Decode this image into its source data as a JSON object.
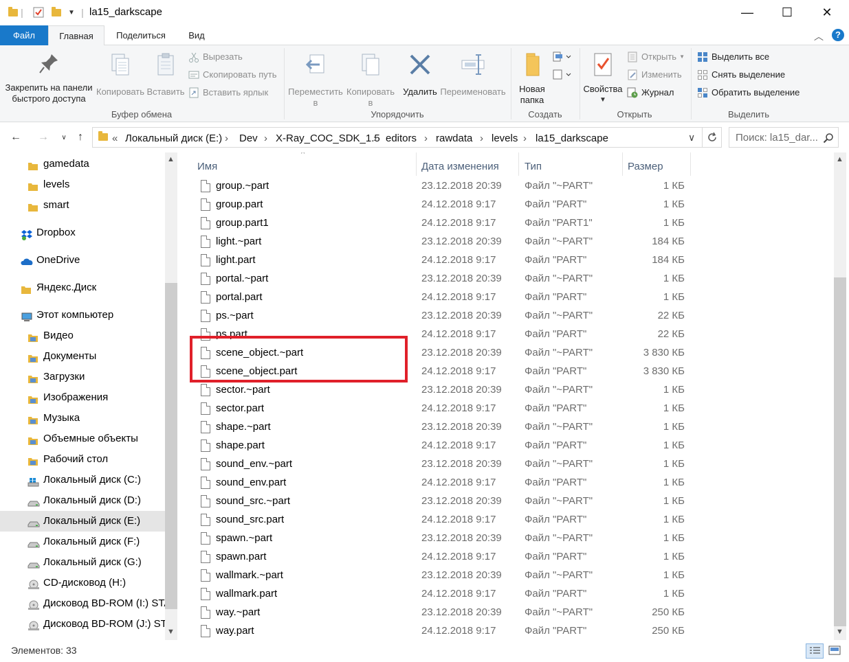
{
  "window": {
    "title": "la15_darkscape",
    "controls": {
      "minimize": "—",
      "maximize": "☐",
      "close": "✕"
    }
  },
  "ribbon_tabs": [
    {
      "label": "Файл"
    },
    {
      "label": "Главная"
    },
    {
      "label": "Поделиться"
    },
    {
      "label": "Вид"
    }
  ],
  "ribbon": {
    "clipboard": {
      "pin_line1": "Закрепить на панели",
      "pin_line2": "быстрого доступа",
      "copy": "Копировать",
      "paste": "Вставить",
      "cut": "Вырезать",
      "copy_path": "Скопировать путь",
      "paste_shortcut": "Вставить ярлык",
      "group": "Буфер обмена"
    },
    "organize": {
      "move_line1": "Переместить",
      "move_line2": "в",
      "copyto_line1": "Копировать",
      "copyto_line2": "в",
      "delete": "Удалить",
      "rename": "Переименовать",
      "group": "Упорядочить"
    },
    "create": {
      "new_folder_line1": "Новая",
      "new_folder_line2": "папка",
      "group": "Создать"
    },
    "open": {
      "properties": "Свойства",
      "open": "Открыть",
      "edit": "Изменить",
      "history": "Журнал",
      "group": "Открыть"
    },
    "select": {
      "select_all": "Выделить все",
      "select_none": "Снять выделение",
      "invert": "Обратить выделение",
      "group": "Выделить"
    }
  },
  "address": {
    "overflow": "«",
    "crumbs": [
      "Локальный диск (E:)",
      "Dev",
      "X-Ray_COC_SDK_1.5",
      "editors",
      "rawdata",
      "levels",
      "la15_darkscape"
    ],
    "search_placeholder": "Поиск: la15_dar..."
  },
  "nav": {
    "items": [
      {
        "label": "gamedata",
        "icon": "folder-icon"
      },
      {
        "label": "levels",
        "icon": "folder-icon"
      },
      {
        "label": "smart",
        "icon": "folder-icon"
      },
      {
        "label": "Dropbox",
        "icon": "dropbox-icon"
      },
      {
        "label": "OneDrive",
        "icon": "onedrive-icon"
      },
      {
        "label": "Яндекс.Диск",
        "icon": "folder-icon"
      },
      {
        "label": "Этот компьютер",
        "icon": "computer-icon"
      },
      {
        "label": "Видео",
        "icon": "video-folder-icon"
      },
      {
        "label": "Документы",
        "icon": "documents-folder-icon"
      },
      {
        "label": "Загрузки",
        "icon": "downloads-folder-icon"
      },
      {
        "label": "Изображения",
        "icon": "pictures-folder-icon"
      },
      {
        "label": "Музыка",
        "icon": "music-folder-icon"
      },
      {
        "label": "Объемные объекты",
        "icon": "3d-objects-folder-icon"
      },
      {
        "label": "Рабочий стол",
        "icon": "desktop-folder-icon"
      },
      {
        "label": "Локальный диск (C:)",
        "icon": "windows-drive-icon"
      },
      {
        "label": "Локальный диск (D:)",
        "icon": "drive-icon"
      },
      {
        "label": "Локальный диск (E:)",
        "icon": "drive-icon"
      },
      {
        "label": "Локальный диск (F:)",
        "icon": "drive-icon"
      },
      {
        "label": "Локальный диск (G:)",
        "icon": "drive-icon"
      },
      {
        "label": "CD-дисковод (H:)",
        "icon": "cd-drive-icon"
      },
      {
        "label": "Дисковод BD-ROM (I:) STA",
        "icon": "cd-drive-icon"
      },
      {
        "label": "Дисковод BD-ROM (J:) STA",
        "icon": "cd-drive-icon"
      }
    ]
  },
  "columns": {
    "name": "Имя",
    "date": "Дата изменения",
    "type": "Тип",
    "size": "Размер"
  },
  "files": [
    {
      "name": "group.~part",
      "date": "23.12.2018 20:39",
      "type": "Файл \"~PART\"",
      "size": "1 КБ"
    },
    {
      "name": "group.part",
      "date": "24.12.2018 9:17",
      "type": "Файл \"PART\"",
      "size": "1 КБ"
    },
    {
      "name": "group.part1",
      "date": "24.12.2018 9:17",
      "type": "Файл \"PART1\"",
      "size": "1 КБ"
    },
    {
      "name": "light.~part",
      "date": "23.12.2018 20:39",
      "type": "Файл \"~PART\"",
      "size": "184 КБ"
    },
    {
      "name": "light.part",
      "date": "24.12.2018 9:17",
      "type": "Файл \"PART\"",
      "size": "184 КБ"
    },
    {
      "name": "portal.~part",
      "date": "23.12.2018 20:39",
      "type": "Файл \"~PART\"",
      "size": "1 КБ"
    },
    {
      "name": "portal.part",
      "date": "24.12.2018 9:17",
      "type": "Файл \"PART\"",
      "size": "1 КБ"
    },
    {
      "name": "ps.~part",
      "date": "23.12.2018 20:39",
      "type": "Файл \"~PART\"",
      "size": "22 КБ"
    },
    {
      "name": "ps.part",
      "date": "24.12.2018 9:17",
      "type": "Файл \"PART\"",
      "size": "22 КБ"
    },
    {
      "name": "scene_object.~part",
      "date": "23.12.2018 20:39",
      "type": "Файл \"~PART\"",
      "size": "3 830 КБ"
    },
    {
      "name": "scene_object.part",
      "date": "24.12.2018 9:17",
      "type": "Файл \"PART\"",
      "size": "3 830 КБ"
    },
    {
      "name": "sector.~part",
      "date": "23.12.2018 20:39",
      "type": "Файл \"~PART\"",
      "size": "1 КБ"
    },
    {
      "name": "sector.part",
      "date": "24.12.2018 9:17",
      "type": "Файл \"PART\"",
      "size": "1 КБ"
    },
    {
      "name": "shape.~part",
      "date": "23.12.2018 20:39",
      "type": "Файл \"~PART\"",
      "size": "1 КБ"
    },
    {
      "name": "shape.part",
      "date": "24.12.2018 9:17",
      "type": "Файл \"PART\"",
      "size": "1 КБ"
    },
    {
      "name": "sound_env.~part",
      "date": "23.12.2018 20:39",
      "type": "Файл \"~PART\"",
      "size": "1 КБ"
    },
    {
      "name": "sound_env.part",
      "date": "24.12.2018 9:17",
      "type": "Файл \"PART\"",
      "size": "1 КБ"
    },
    {
      "name": "sound_src.~part",
      "date": "23.12.2018 20:39",
      "type": "Файл \"~PART\"",
      "size": "1 КБ"
    },
    {
      "name": "sound_src.part",
      "date": "24.12.2018 9:17",
      "type": "Файл \"PART\"",
      "size": "1 КБ"
    },
    {
      "name": "spawn.~part",
      "date": "23.12.2018 20:39",
      "type": "Файл \"~PART\"",
      "size": "1 КБ"
    },
    {
      "name": "spawn.part",
      "date": "24.12.2018 9:17",
      "type": "Файл \"PART\"",
      "size": "1 КБ"
    },
    {
      "name": "wallmark.~part",
      "date": "23.12.2018 20:39",
      "type": "Файл \"~PART\"",
      "size": "1 КБ"
    },
    {
      "name": "wallmark.part",
      "date": "24.12.2018 9:17",
      "type": "Файл \"PART\"",
      "size": "1 КБ"
    },
    {
      "name": "way.~part",
      "date": "23.12.2018 20:39",
      "type": "Файл \"~PART\"",
      "size": "250 КБ"
    },
    {
      "name": "way.part",
      "date": "24.12.2018 9:17",
      "type": "Файл \"PART\"",
      "size": "250 КБ"
    }
  ],
  "status": {
    "count": "Элементов: 33"
  },
  "colors": {
    "accent": "#1979ca",
    "highlight_box": "#e0202a",
    "folder": "#e8b73c"
  }
}
